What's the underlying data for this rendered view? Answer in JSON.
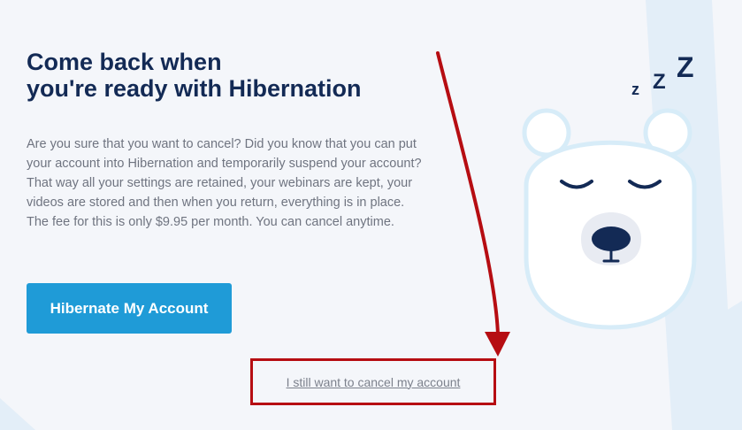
{
  "page": {
    "title_line1": "Come back when",
    "title_line2": "you're ready with Hibernation",
    "description": "Are you sure that you want to cancel? Did you know that you can put your account into Hibernation and temporarily suspend your account? That way all your settings are retained, your webinars are kept, your videos are stored and then when you return, everything is in place. The fee for this is only $9.95 per month. You can cancel anytime."
  },
  "actions": {
    "hibernate_label": "Hibernate My Account",
    "cancel_link_label": "I still want to cancel my account"
  },
  "illustration": {
    "icon": "sleeping-polar-bear-icon",
    "zzz_icon": "sleep-zzz-icon"
  },
  "colors": {
    "background": "#f4f6fa",
    "heading": "#132a55",
    "body_text": "#6f7480",
    "primary_button": "#1f9bd7",
    "annotation_red": "#b60d12",
    "bear_outline": "#d7ecf8"
  }
}
